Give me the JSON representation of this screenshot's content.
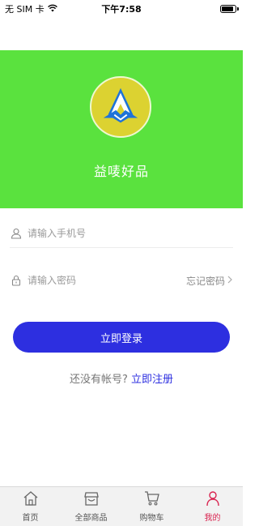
{
  "status_bar": {
    "carrier": "无 SIM 卡",
    "time": "下午7:58",
    "battery_level": 0.85
  },
  "brand": {
    "name": "益唛好品",
    "logo_icon": "brand-logo-icon",
    "hero_color": "#5ae23e",
    "logo_bg": "#dcd231"
  },
  "form": {
    "phone_placeholder": "请输入手机号",
    "password_placeholder": "请输入密码",
    "forgot_label": "忘记密码",
    "login_label": "立即登录",
    "accent": "#2d2fe0"
  },
  "register": {
    "prompt": "还没有帐号?",
    "link": "立即注册"
  },
  "tabbar": {
    "tabs": [
      {
        "label": "首页",
        "icon": "home-icon"
      },
      {
        "label": "全部商品",
        "icon": "store-icon"
      },
      {
        "label": "购物车",
        "icon": "cart-icon"
      },
      {
        "label": "我的",
        "icon": "user-icon"
      }
    ],
    "active_color": "#d9234f"
  }
}
